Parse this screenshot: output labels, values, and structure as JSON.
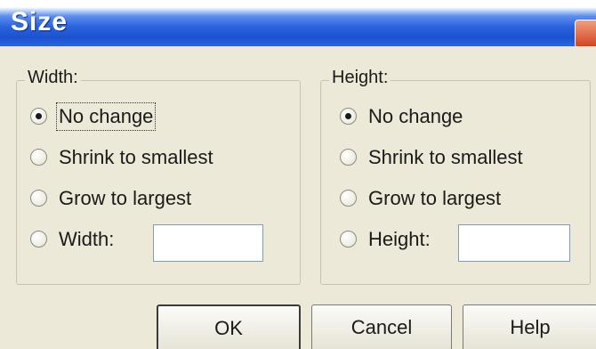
{
  "dialog": {
    "title": "Size"
  },
  "width_group": {
    "legend": "Width:",
    "options": [
      {
        "label": "No change",
        "checked": true
      },
      {
        "label": "Shrink to smallest",
        "checked": false
      },
      {
        "label": "Grow to largest",
        "checked": false
      },
      {
        "label": "Width:",
        "checked": false
      }
    ],
    "input_value": ""
  },
  "height_group": {
    "legend": "Height:",
    "options": [
      {
        "label": "No change",
        "checked": true
      },
      {
        "label": "Shrink to smallest",
        "checked": false
      },
      {
        "label": "Grow to largest",
        "checked": false
      },
      {
        "label": "Height:",
        "checked": false
      }
    ],
    "input_value": ""
  },
  "buttons": {
    "ok": "OK",
    "cancel": "Cancel",
    "help": "Help"
  },
  "colors": {
    "titlebar": "#2a63de",
    "face": "#ece9d8",
    "close_button": "#d04020"
  }
}
